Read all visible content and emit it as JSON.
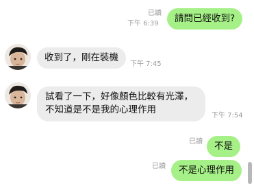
{
  "messages": [
    {
      "direction": "out",
      "text": "請問已經收到?",
      "read": "已讀",
      "time": "下午 6:39"
    },
    {
      "direction": "in",
      "text": "收到了，剛在裝機",
      "time": "下午 7:45"
    },
    {
      "direction": "in",
      "text": "試看了一下，好像顏色比較有光澤，不知道是不是我的心理作用",
      "time": "下午 7:54"
    },
    {
      "direction": "out",
      "text": "不是",
      "read": "已讀"
    },
    {
      "direction": "out",
      "text": "不是心理作用",
      "read": "已讀"
    }
  ],
  "colors": {
    "outgoing_bubble": "#a5f087",
    "incoming_bubble": "#ececec",
    "meta_text": "#9a9a9a"
  }
}
